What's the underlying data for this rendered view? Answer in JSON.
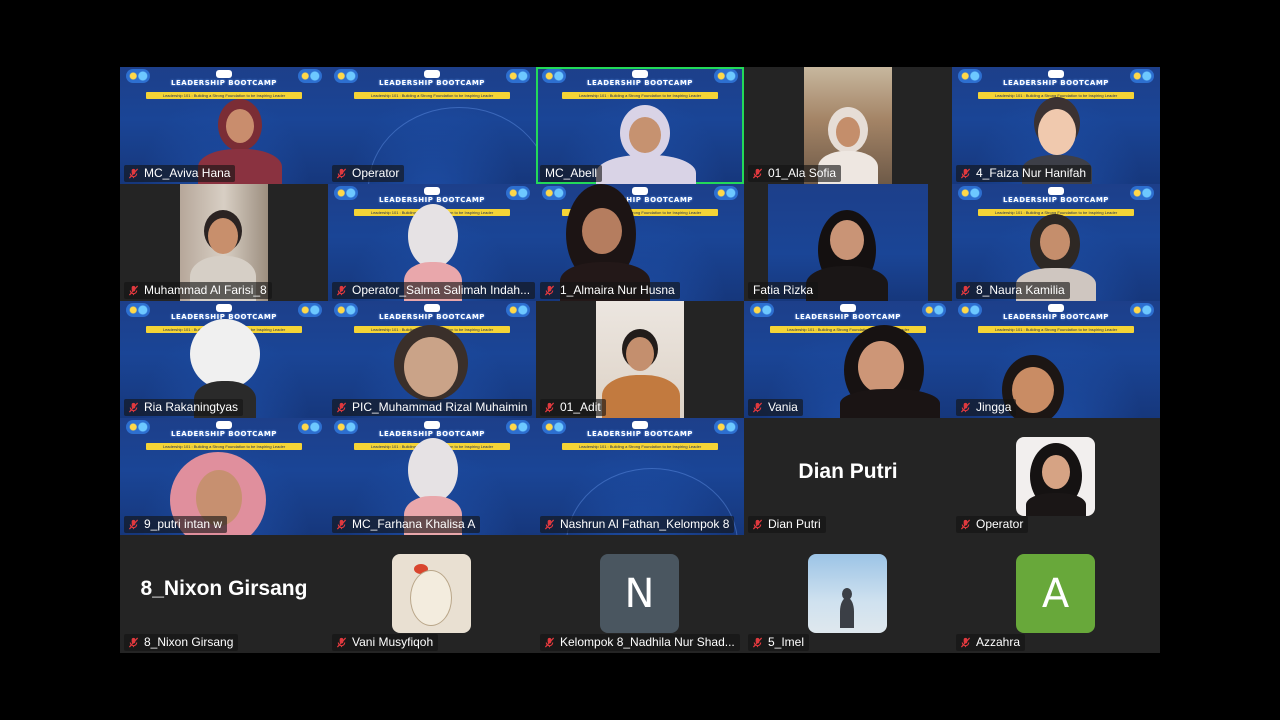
{
  "banner": {
    "title": "LEADERSHIP BOOTCAMP",
    "subtitle": "Leadership 101 : Building a Strong Foundation to be Inspiring Leader",
    "logo": "idnu"
  },
  "participants": [
    {
      "name": "MC_Aviva Hana",
      "muted": true
    },
    {
      "name": "Operator",
      "muted": true
    },
    {
      "name": "MC_Abell",
      "muted": false,
      "active_speaker": true
    },
    {
      "name": "01_Ala Sofia",
      "muted": true
    },
    {
      "name": "4_Faiza Nur Hanifah",
      "muted": true
    },
    {
      "name": "Muhammad Al Farisi_8",
      "muted": true
    },
    {
      "name": "Operator_Salma Salimah Indah...",
      "muted": true
    },
    {
      "name": "1_Almaira Nur Husna",
      "muted": true
    },
    {
      "name": "Fatia Rizka",
      "muted": false
    },
    {
      "name": "8_Naura Kamilia",
      "muted": true
    },
    {
      "name": "Ria Rakaningtyas",
      "muted": true
    },
    {
      "name": "PIC_Muhammad Rizal Muhaimin",
      "muted": true
    },
    {
      "name": "01_Adit",
      "muted": true
    },
    {
      "name": "Vania",
      "muted": true
    },
    {
      "name": "Jingga",
      "muted": true
    },
    {
      "name": "9_putri intan w",
      "muted": true
    },
    {
      "name": "MC_Farhana Khalisa A",
      "muted": true
    },
    {
      "name": "Nashrun Al Fathan_Kelompok 8",
      "muted": true
    },
    {
      "name": "Dian Putri",
      "muted": true,
      "display_name": "Dian Putri"
    },
    {
      "name": "Operator",
      "muted": true
    },
    {
      "name": "8_Nixon Girsang",
      "muted": true,
      "display_name": "8_Nixon Girsang"
    },
    {
      "name": "Vani Musyfiqoh",
      "muted": true
    },
    {
      "name": "Kelompok 8_Nadhila Nur Shad...",
      "muted": true,
      "avatar_letter": "N"
    },
    {
      "name": "5_Imel",
      "muted": true
    },
    {
      "name": "Azzahra",
      "muted": true,
      "avatar_letter": "A"
    }
  ],
  "colors": {
    "active_speaker_border": "#23d959",
    "muted_icon": "#e0393e",
    "avatar_n": "#4a5660",
    "avatar_a": "#68a83a"
  }
}
